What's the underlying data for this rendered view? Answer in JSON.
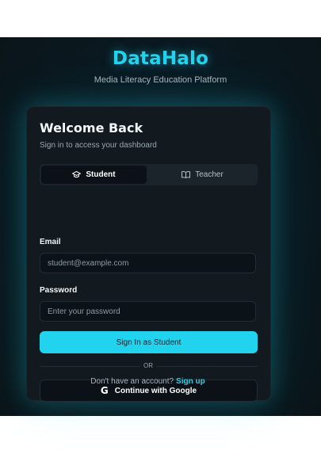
{
  "brand": {
    "name": "DataHalo",
    "tagline": "Media Literacy Education Platform"
  },
  "card": {
    "title": "Welcome Back",
    "subtitle": "Sign in to access your dashboard"
  },
  "role_toggle": {
    "options": [
      {
        "label": "Student",
        "icon": "graduation-cap-icon",
        "active": true
      },
      {
        "label": "Teacher",
        "icon": "book-icon",
        "active": false
      }
    ]
  },
  "email": {
    "label": "Email",
    "placeholder": "student@example.com"
  },
  "password": {
    "label": "Password",
    "placeholder": "Enter your password"
  },
  "sign_in_button": "Sign In as Student",
  "divider_text": "OR",
  "google_button": {
    "label": "Continue with Google",
    "icon": "google-icon"
  },
  "footer": {
    "prompt": "Don't have an account?",
    "link": "Sign up"
  },
  "colors": {
    "accent": "#22d3ee",
    "card_bg": "#121a20",
    "page_bg": "#0a1418"
  }
}
